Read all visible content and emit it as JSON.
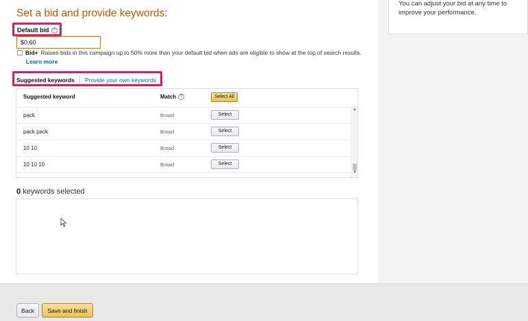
{
  "page": {
    "title": "Set a bid and provide keywords:"
  },
  "right_panel": {
    "tip_line1": "You can adjust your bid at any time to",
    "tip_line2": "improve your performance."
  },
  "default_bid": {
    "label": "Default bid",
    "help_icon": "question-circle-icon",
    "value": "$0.60"
  },
  "bid_plus": {
    "label": "Bid+",
    "description": "Raises bids in this campaign up to 50% more than your default bid when ads are eligible to show at the top of search results.",
    "checked": false,
    "learn_more": "Learn more"
  },
  "keyword_tabs": {
    "suggested": "Suggested keywords",
    "own": "Provide your own keywords"
  },
  "keyword_table": {
    "col_keyword": "Suggested keyword",
    "col_match": "Match",
    "select_all": "Select All",
    "rows": [
      {
        "keyword": "pack",
        "match": "Broad",
        "action": "Select"
      },
      {
        "keyword": "pack pack",
        "match": "Broad",
        "action": "Select"
      },
      {
        "keyword": "10 10",
        "match": "Broad",
        "action": "Select"
      },
      {
        "keyword": "10 10 10",
        "match": "Broad",
        "action": "Select"
      }
    ]
  },
  "selected": {
    "count": "0",
    "label": "keywords selected"
  },
  "footer": {
    "back": "Back",
    "save": "Save and finish"
  },
  "colors": {
    "title": "#c45500",
    "highlight": "#e0196b",
    "link": "#0066c0",
    "primary_button": "#f0c14b"
  }
}
